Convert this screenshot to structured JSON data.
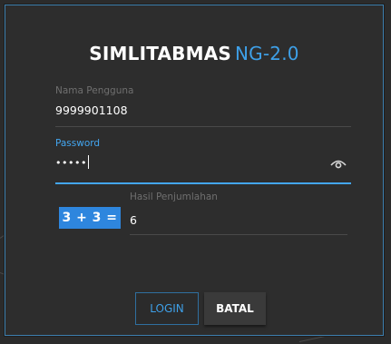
{
  "app": {
    "brand": "SIMLITABMAS",
    "version": "NG-2.0"
  },
  "form": {
    "username": {
      "label": "Nama Pengguna",
      "value": "9999901108"
    },
    "password": {
      "label": "Password",
      "value": "•••••"
    },
    "captcha": {
      "question": "3 + 3 =",
      "label": "Hasil Penjumlahan",
      "value": "6"
    }
  },
  "actions": {
    "login_label": "LOGIN",
    "cancel_label": "BATAL"
  },
  "icons": {
    "password_toggle": "eye-icon"
  },
  "colors": {
    "accent": "#3ea0e8",
    "captcha_bg": "#2e86de",
    "dialog_bg": "#2d2d2d"
  }
}
